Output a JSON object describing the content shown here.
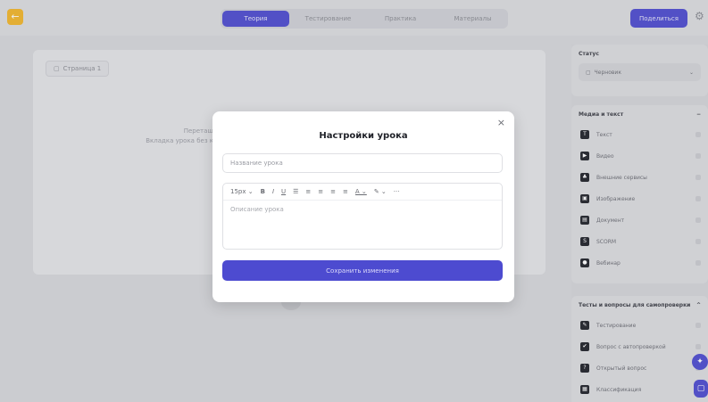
{
  "topbar": {
    "back_icon": "←",
    "tabs": [
      {
        "label": "Теория",
        "active": true
      },
      {
        "label": "Тестирование",
        "active": false
      },
      {
        "label": "Практика",
        "active": false
      },
      {
        "label": "Материалы",
        "active": false
      }
    ],
    "publish_label": "Поделиться",
    "settings_icon": "⚙"
  },
  "canvas": {
    "page_label": "Страница 1",
    "hint_line1": "Перетащ",
    "hint_line2": "Вкладка урока без к"
  },
  "sidebar": {
    "status_title": "Статус",
    "status_value": "Черновик",
    "media_title": "Медиа и текст",
    "media_items": [
      {
        "label": "Текст",
        "icon": "T"
      },
      {
        "label": "Видео",
        "icon": "▶"
      },
      {
        "label": "Внешние сервисы",
        "icon": "♣"
      },
      {
        "label": "Изображение",
        "icon": "▣"
      },
      {
        "label": "Документ",
        "icon": "▤"
      },
      {
        "label": "SCORM",
        "icon": "S"
      },
      {
        "label": "Вебинар",
        "icon": "●"
      }
    ],
    "tests_title": "Тесты и вопросы для самопроверки",
    "tests_items": [
      {
        "label": "Тестирование",
        "icon": "✎"
      },
      {
        "label": "Вопрос с автопроверкой",
        "icon": "✔"
      },
      {
        "label": "Открытый вопрос",
        "icon": "?"
      },
      {
        "label": "Классификация",
        "icon": "▦"
      }
    ],
    "collapse_icon": "−",
    "expand_icon": "^"
  },
  "modal": {
    "title": "Настройки урока",
    "close_icon": "×",
    "title_placeholder": "Название урока",
    "toolbar_font_size": "15px",
    "description_placeholder": "Описание урока",
    "save_label": "Сохранить изменения"
  },
  "colors": {
    "accent": "#4d4bd0",
    "back_button": "#f2b62a"
  }
}
